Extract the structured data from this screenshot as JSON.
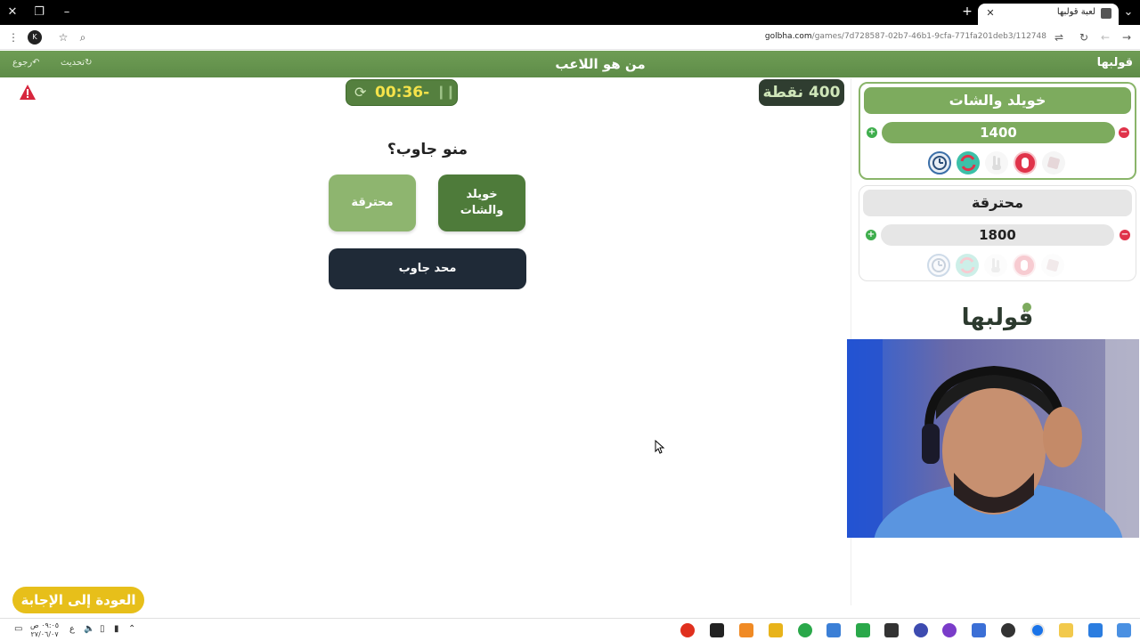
{
  "browser": {
    "tab_title": "لعبة قولبها",
    "url_domain": "golbha.com",
    "url_path": "/games/7d728587-02b7-46b1-9cfa-771fa201deb3/112748",
    "profile_initial": "K"
  },
  "header": {
    "title": "من هو اللاعب",
    "refresh_label": "تحديث",
    "back_label": "رجوع",
    "logo": "قولبها"
  },
  "game": {
    "timer": "00:36-",
    "points": "400 نقطة",
    "question": "منو جاوب؟",
    "answer_team_a": "خويلد والشات",
    "answer_team_b": "محترقة",
    "nobody_label": "محد جاوب",
    "back_to_answer": "العودة إلى الإجابة"
  },
  "teams": [
    {
      "name": "خويلد والشات",
      "score": "1400",
      "active": true
    },
    {
      "name": "محترقة",
      "score": "1800",
      "active": false
    }
  ],
  "helper_icons": [
    "clock-icon",
    "swap-icon",
    "two-fingers-icon",
    "hand-stop-icon",
    "dice-icon"
  ],
  "logo_mid": "قولبها",
  "taskbar": {
    "clock_time": "٠٩:٠٥ ص",
    "clock_date": "٢٧/٠٦/٠٧",
    "lang": "ع"
  },
  "colors": {
    "brand_green": "#6f9d55",
    "dark_green": "#4e7b3a",
    "timer_text": "#f5e34a",
    "nobody_bg": "#1f2a37",
    "back_button": "#e7bf1a"
  }
}
